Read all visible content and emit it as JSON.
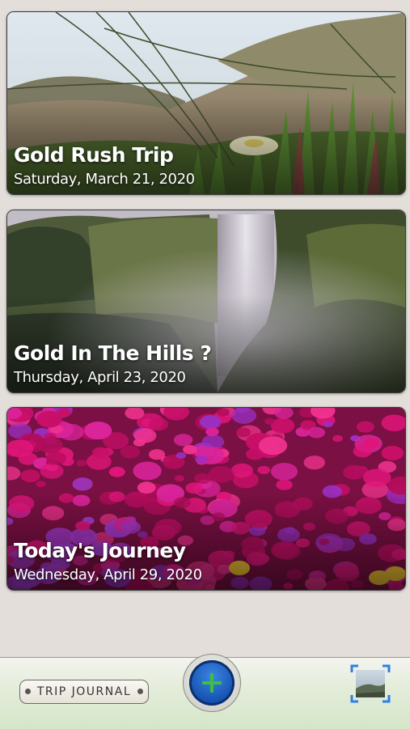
{
  "trips": [
    {
      "title": "Gold Rush Trip",
      "date": "Saturday, March 21, 2020",
      "photo_icon": "coastal-grass-flower-photo"
    },
    {
      "title": "Gold In The Hills ?",
      "date": "Thursday, April 23, 2020",
      "photo_icon": "waterfall-photo"
    },
    {
      "title": "Today's Journey",
      "date": "Wednesday, April 29, 2020",
      "photo_icon": "pink-flowers-photo"
    }
  ],
  "toolbar": {
    "journal_label": "TRIP JOURNAL",
    "add_icon": "plus-icon",
    "photo_icon": "photo-crop-icon"
  },
  "colors": {
    "background": "#e3ded9",
    "add_button": "#1f63c6",
    "plus": "#3fbf3f",
    "photo_frame": "#2f7fe6"
  }
}
